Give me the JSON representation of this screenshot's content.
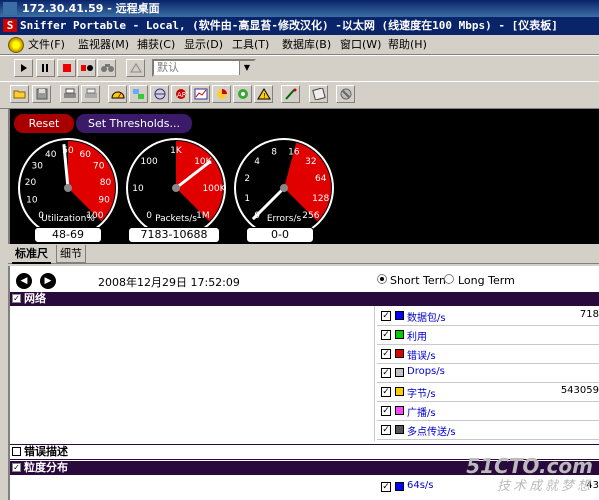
{
  "remote_title": "172.30.41.59 - 远程桌面",
  "app_title": "Sniffer Portable - Local, (软件由-高显苔-修改汉化) -以太网 (线速度在100 Mbps) - [仪表板]",
  "menu": [
    "文件(F)",
    "监视器(M)",
    "捕获(C)",
    "显示(D)",
    "工具(T)",
    "数据库(B)",
    "窗口(W)",
    "帮助(H)"
  ],
  "toolbar1": {
    "buttons": [
      "play-icon",
      "pause-icon",
      "stop-icon",
      "stop-view-icon",
      "binoculars-icon",
      "capture-filter-icon"
    ],
    "filter_value": "默认"
  },
  "toolbar2": {
    "buttons": [
      "open-icon",
      "save-icon",
      "print-icon",
      "print-setup-icon",
      "dashboard-icon",
      "host-table-icon",
      "matrix-icon",
      "art-icon",
      "history-icon",
      "protocol-dist-icon",
      "global-stats-icon",
      "alarm-icon",
      "expert-icon",
      "address-book-icon",
      "reset-icon"
    ]
  },
  "dashboard": {
    "reset_label": "Reset",
    "thresholds_label": "Set Thresholds...",
    "gauges": [
      {
        "name": "Utilization%",
        "ticks": [
          "0",
          "10",
          "20",
          "30",
          "40",
          "50",
          "60",
          "70",
          "80",
          "90",
          "100"
        ],
        "needle_value": 48,
        "red_from": 50,
        "range_label": "48-69"
      },
      {
        "name": "Packets/s",
        "ticks": [
          "0",
          "10",
          "100",
          "1K",
          "10K",
          "100K",
          "1M"
        ],
        "needle_value": 7183,
        "red_from_tick": 3,
        "range_label": "7183-10688"
      },
      {
        "name": "Errors/s",
        "ticks": [
          "0",
          "1",
          "2",
          "4",
          "8",
          "16",
          "32",
          "64",
          "128",
          "256"
        ],
        "needle_value": 0,
        "red_from_tick": 5,
        "range_label": "0-0"
      }
    ]
  },
  "tabs": [
    "标准尺",
    "细节"
  ],
  "content": {
    "datetime": "2008年12月29日 17:52:09",
    "short_term": "Short Term",
    "long_term": "Long Term",
    "sections": {
      "network": "网络",
      "error_desc": "错误描述",
      "size_dist": "粒度分布"
    },
    "rows": [
      {
        "label": "数据包/s",
        "color": "#0000ff",
        "value": "718"
      },
      {
        "label": "利用",
        "color": "#00cc00",
        "value": ""
      },
      {
        "label": "错误/s",
        "color": "#dd0000",
        "value": ""
      },
      {
        "label": "Drops/s",
        "color": "#c0c0c0",
        "value": ""
      },
      {
        "label": "字节/s",
        "color": "#ffcc00",
        "value": "543059"
      },
      {
        "label": "广播/s",
        "color": "#ff44ff",
        "value": ""
      },
      {
        "label": "多点传送/s",
        "color": "#555555",
        "value": ""
      }
    ],
    "size_rows": [
      {
        "label": "64s/s",
        "color": "#0000ff",
        "value": "43"
      }
    ],
    "watermark_line1": "51CTO.com",
    "watermark_line2": "技术成就梦想"
  }
}
